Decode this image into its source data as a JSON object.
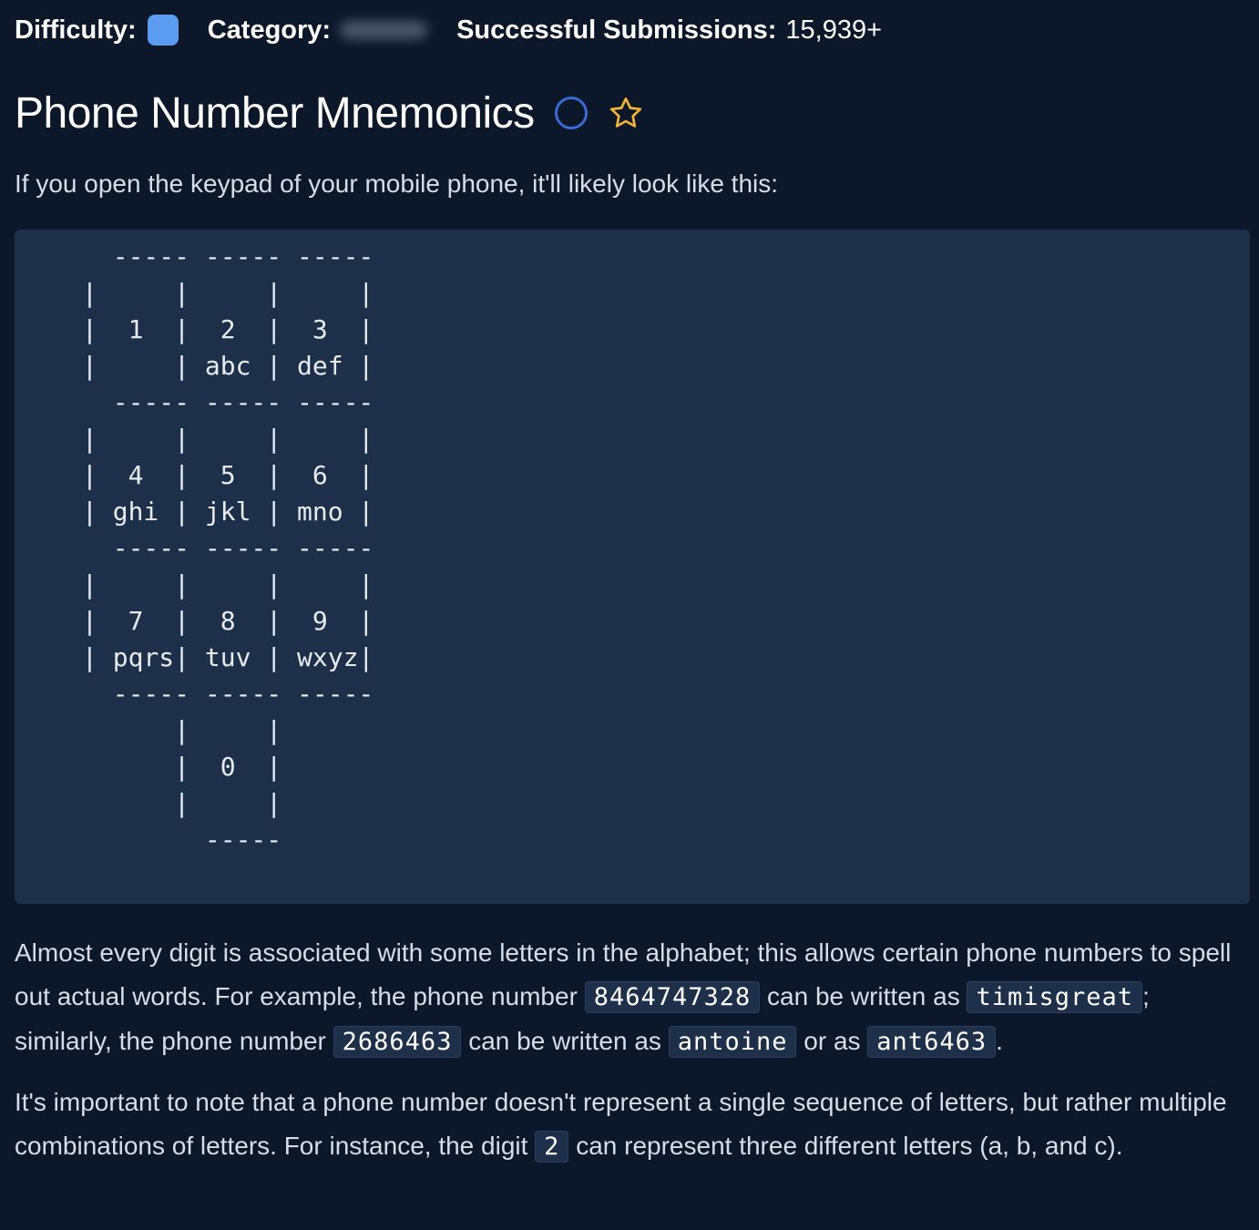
{
  "meta": {
    "difficulty_label": "Difficulty:",
    "difficulty_color": "#5b9cf0",
    "category_label": "Category:",
    "submissions_label": "Successful Submissions:",
    "submissions_value": "15,939+"
  },
  "title": "Phone Number Mnemonics",
  "icons": {
    "complete": "circle-outline-icon",
    "favorite": "star-outline-icon"
  },
  "intro": "If you open the keypad of your mobile phone, it'll likely look like this:",
  "keypad_ascii": "  ----- ----- -----\n|     |     |     |\n|  1  |  2  |  3  |\n|     | abc | def |\n  ----- ----- -----\n|     |     |     |\n|  4  |  5  |  6  |\n| ghi | jkl | mno |\n  ----- ----- -----\n|     |     |     |\n|  7  |  8  |  9  |\n| pqrs| tuv | wxyz|\n  ----- ----- -----\n      |     |\n      |  0  |\n      |     |\n        -----",
  "paragraph1": {
    "t1": "Almost every digit is associated with some letters in the alphabet; this allows certain phone numbers to spell out actual words. For example, the phone number ",
    "c1": "8464747328",
    "t2": " can be written as ",
    "c2": "timisgreat",
    "t3": "; similarly, the phone number ",
    "c3": "2686463",
    "t4": " can be written as ",
    "c4": "antoine",
    "t5": " or as ",
    "c5": "ant6463",
    "t6": "."
  },
  "paragraph2": {
    "t1": "It's important to note that a phone number doesn't represent a single sequence of letters, but rather multiple combinations of letters. For instance, the digit ",
    "c1": "2",
    "t2": " can represent three different letters (a, b, and c)."
  }
}
